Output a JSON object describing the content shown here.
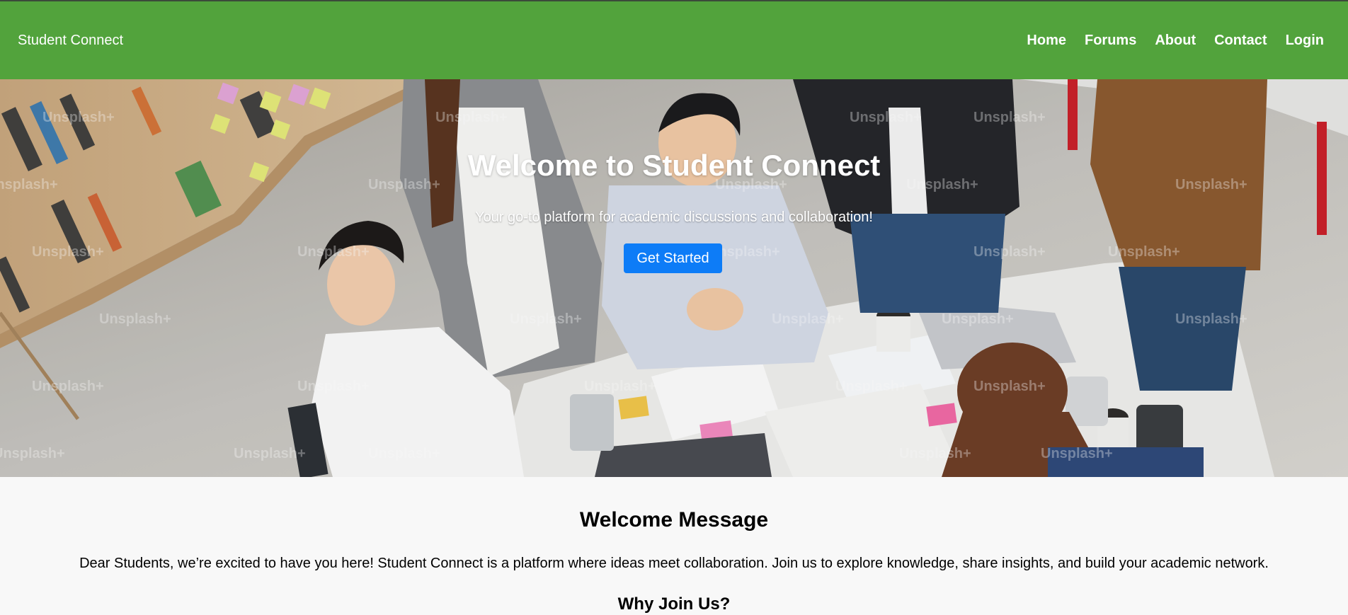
{
  "header": {
    "brand": "Student Connect",
    "nav": [
      "Home",
      "Forums",
      "About",
      "Contact",
      "Login"
    ],
    "color": "#52a33c"
  },
  "hero": {
    "title": "Welcome to Student Connect",
    "subtitle": "Your go-to platform for academic discussions and collaboration!",
    "cta_label": "Get Started",
    "cta_color": "#0d7cf7",
    "image_subject": "students-collaborating-around-table-photo",
    "watermark": "Unsplash+"
  },
  "content": {
    "heading": "Welcome Message",
    "message": "Dear Students, we’re excited to have you here! Student Connect is a platform where ideas meet collaboration. Join us to explore knowledge, share insights, and build your academic network.",
    "subheading": "Why Join Us?"
  }
}
